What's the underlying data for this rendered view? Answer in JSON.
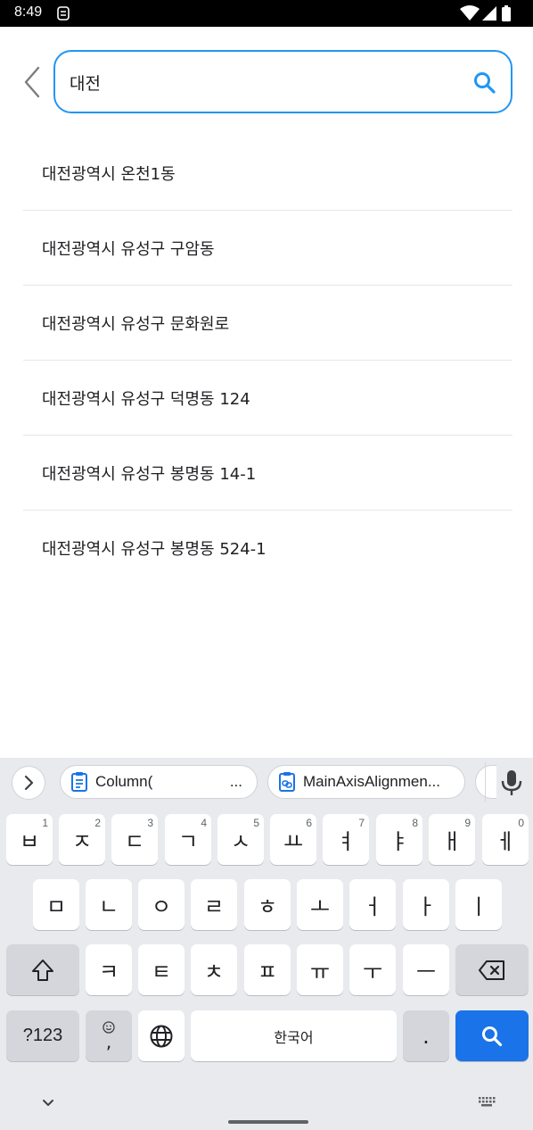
{
  "status_bar": {
    "time": "8:49",
    "icons": [
      "notification-app-icon",
      "wifi-icon",
      "signal-icon",
      "battery-icon"
    ]
  },
  "search": {
    "query": "대전",
    "accent_color": "#2196f3"
  },
  "results": [
    "대전광역시 온천1동",
    "대전광역시 유성구 구암동",
    "대전광역시 유성구 문화원로",
    "대전광역시 유성구 덕명동 124",
    "대전광역시 유성구 봉명동 14-1",
    "대전광역시 유성구 봉명동 524-1"
  ],
  "keyboard": {
    "suggestions": {
      "chip_1": {
        "text": "Column(",
        "ellipsis": "..."
      },
      "chip_2": {
        "text": "MainAxisAlignmen..."
      }
    },
    "row1": [
      {
        "label": "ㅂ",
        "hint": "1"
      },
      {
        "label": "ㅈ",
        "hint": "2"
      },
      {
        "label": "ㄷ",
        "hint": "3"
      },
      {
        "label": "ㄱ",
        "hint": "4"
      },
      {
        "label": "ㅅ",
        "hint": "5"
      },
      {
        "label": "ㅛ",
        "hint": "6"
      },
      {
        "label": "ㅕ",
        "hint": "7"
      },
      {
        "label": "ㅑ",
        "hint": "8"
      },
      {
        "label": "ㅐ",
        "hint": "9"
      },
      {
        "label": "ㅔ",
        "hint": "0"
      }
    ],
    "row2": [
      "ㅁ",
      "ㄴ",
      "ㅇ",
      "ㄹ",
      "ㅎ",
      "ㅗ",
      "ㅓ",
      "ㅏ",
      "ㅣ"
    ],
    "row3": [
      "ㅋ",
      "ㅌ",
      "ㅊ",
      "ㅍ",
      "ㅠ",
      "ㅜ",
      "ㅡ"
    ],
    "symbols_label": "?123",
    "emoji_comma": ",",
    "space_label": "한국어",
    "period_label": ".",
    "enter_color": "#1a73e8"
  }
}
